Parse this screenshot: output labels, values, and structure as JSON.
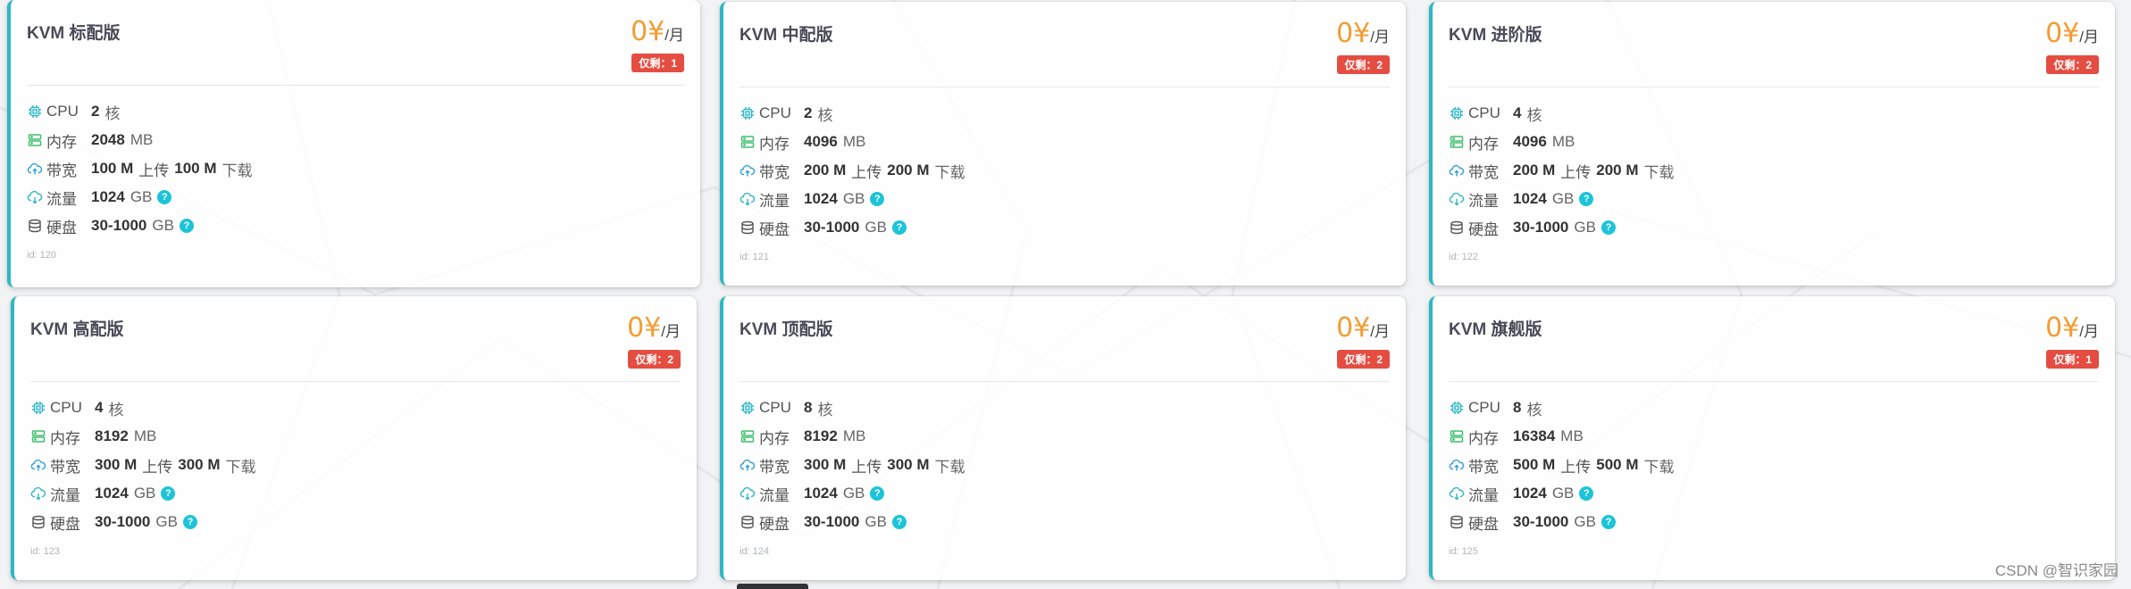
{
  "watermark": "CSDN @智识家园",
  "currency": "¥",
  "period": "/月",
  "spec_labels": {
    "cpu": "CPU",
    "memory": "内存",
    "bandwidth": "带宽",
    "traffic": "流量",
    "disk": "硬盘"
  },
  "units": {
    "cores": "核",
    "mb": "MB",
    "gb": "GB",
    "upload": "上传",
    "download": "下载"
  },
  "help_glyph": "?",
  "colors": {
    "accent": "#2db7c5",
    "price": "#f39c32",
    "badge": "#e54d42",
    "help": "#1cc4d8"
  },
  "icons": [
    "cpu-icon",
    "memory-icon",
    "cloud-upload-icon",
    "cloud-download-icon",
    "database-icon"
  ],
  "plans": [
    {
      "name": "KVM 标配版",
      "price": "0",
      "stock": "仅剩：1",
      "cpu": "2",
      "memory": "2048",
      "bw_up": "100 M",
      "bw_down": "100 M",
      "traffic": "1024",
      "disk": "30-1000",
      "id": "id: 120"
    },
    {
      "name": "KVM 中配版",
      "price": "0",
      "stock": "仅剩：2",
      "cpu": "2",
      "memory": "4096",
      "bw_up": "200 M",
      "bw_down": "200 M",
      "traffic": "1024",
      "disk": "30-1000",
      "id": "id: 121"
    },
    {
      "name": "KVM 进阶版",
      "price": "0",
      "stock": "仅剩：2",
      "cpu": "4",
      "memory": "4096",
      "bw_up": "200 M",
      "bw_down": "200 M",
      "traffic": "1024",
      "disk": "30-1000",
      "id": "id: 122"
    },
    {
      "name": "KVM 高配版",
      "price": "0",
      "stock": "仅剩：2",
      "cpu": "4",
      "memory": "8192",
      "bw_up": "300 M",
      "bw_down": "300 M",
      "traffic": "1024",
      "disk": "30-1000",
      "id": "id: 123"
    },
    {
      "name": "KVM 顶配版",
      "price": "0",
      "stock": "仅剩：2",
      "cpu": "8",
      "memory": "8192",
      "bw_up": "300 M",
      "bw_down": "300 M",
      "traffic": "1024",
      "disk": "30-1000",
      "id": "id: 124"
    },
    {
      "name": "KVM 旗舰版",
      "price": "0",
      "stock": "仅剩：1",
      "cpu": "8",
      "memory": "16384",
      "bw_up": "500 M",
      "bw_down": "500 M",
      "traffic": "1024",
      "disk": "30-1000",
      "id": "id: 125"
    }
  ]
}
